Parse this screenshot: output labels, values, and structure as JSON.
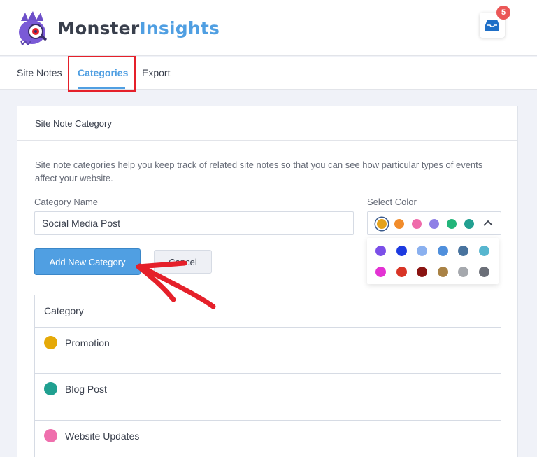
{
  "header": {
    "brand_part1": "Monster",
    "brand_part2": "Insights",
    "notification_count": "5",
    "logo_icon": "monster-mascot-icon",
    "inbox_icon": "inbox-icon"
  },
  "tabs": [
    {
      "label": "Site Notes",
      "active": false
    },
    {
      "label": "Categories",
      "active": true
    },
    {
      "label": "Export",
      "active": false
    }
  ],
  "card": {
    "title": "Site Note Category",
    "description": "Site note categories help you keep track of related site notes so that you can see how particular types of events affect your website."
  },
  "form": {
    "name_label": "Category Name",
    "name_value": "Social Media Post",
    "color_label": "Select Color",
    "selected_colors": [
      "#e5a21b",
      "#f18c2b",
      "#ef6bab",
      "#8e7fe6",
      "#22b57a",
      "#22a091"
    ],
    "palette": [
      [
        "#7b4fe8",
        "#1d3ae0",
        "#8ab0ef",
        "#4f8fdc",
        "#48739e",
        "#57b6cf"
      ],
      [
        "#e332d3",
        "#d83426",
        "#8a1412",
        "#a98245",
        "#a5a8ad",
        "#6b6f78"
      ]
    ],
    "add_button": "Add New Category",
    "cancel_button": "Cancel"
  },
  "table": {
    "header": "Category",
    "rows": [
      {
        "name": "Promotion",
        "color": "#e5a908"
      },
      {
        "name": "Blog Post",
        "color": "#20a090"
      },
      {
        "name": "Website Updates",
        "color": "#ef6fad"
      }
    ]
  },
  "accent": "#509fe2",
  "annotation_color": "#e5202a"
}
